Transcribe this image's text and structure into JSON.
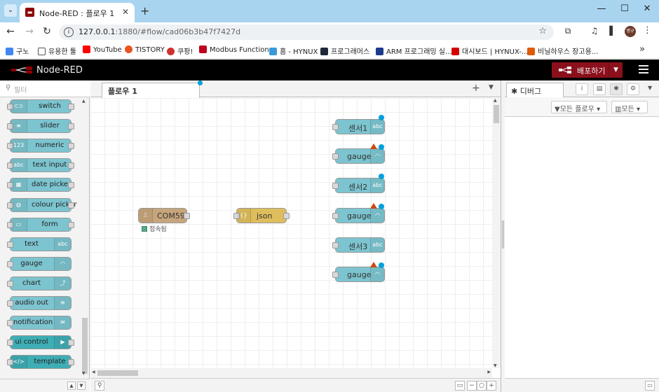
{
  "browser": {
    "tab_title": "Node-RED : 플로우 1",
    "url_host": "127.0.0.1",
    "url_path": ":1880/#flow/cad06b3b47f7427d",
    "profile_label": "병규",
    "bookmarks": [
      {
        "label": "구노",
        "color": "#4285f4"
      },
      {
        "label": "유용한 툴",
        "color": "#555555"
      },
      {
        "label": "YouTube",
        "color": "#ff0000"
      },
      {
        "label": "TISTORY",
        "color": "#eb531f"
      },
      {
        "label": "쿠팡!",
        "color": "#d03030"
      },
      {
        "label": "Modbus Function...",
        "color": "#c00020"
      },
      {
        "label": "홈 - HYNUX",
        "color": "#3a9ad9"
      },
      {
        "label": "프로그래머스",
        "color": "#1e2a3a"
      },
      {
        "label": "ARM 프로그래밍 실...",
        "color": "#1a3a8a"
      },
      {
        "label": "대시보드 | HYNUX-...",
        "color": "#d40000"
      },
      {
        "label": "비닐하우스 장고용...",
        "color": "#e05a00"
      }
    ]
  },
  "nodered": {
    "title": "Node-RED",
    "deploy_label": "배포하기",
    "accent": "#8c101c"
  },
  "palette": {
    "filter_placeholder": "필터",
    "nodes": [
      {
        "label": "switch",
        "icon": "toggle-icon",
        "side": "left",
        "style": "light"
      },
      {
        "label": "slider",
        "icon": "slider-icon",
        "side": "left",
        "style": "light"
      },
      {
        "label": "numeric",
        "icon": "123",
        "side": "left",
        "style": "light"
      },
      {
        "label": "text input",
        "icon": "abc",
        "side": "left",
        "style": "light"
      },
      {
        "label": "date picker",
        "icon": "calendar-icon",
        "side": "left",
        "style": "light"
      },
      {
        "label": "colour picker",
        "icon": "palette-icon",
        "side": "left",
        "style": "light"
      },
      {
        "label": "form",
        "icon": "form-icon",
        "side": "left",
        "style": "light"
      },
      {
        "label": "text",
        "icon": "abc",
        "side": "right",
        "style": "light"
      },
      {
        "label": "gauge",
        "icon": "gauge-icon",
        "side": "right",
        "style": "light"
      },
      {
        "label": "chart",
        "icon": "chart-icon",
        "side": "right",
        "style": "light"
      },
      {
        "label": "audio out",
        "icon": "wifi-icon",
        "side": "right",
        "style": "light"
      },
      {
        "label": "notification",
        "icon": "envelope-icon",
        "side": "right",
        "style": "light"
      },
      {
        "label": "ui control",
        "icon": "play-icon",
        "side": "right",
        "style": "dark"
      },
      {
        "label": "template",
        "icon": "code-icon",
        "side": "left",
        "style": "dark"
      }
    ]
  },
  "workspace": {
    "tab_label": "플로우 1",
    "nodes": {
      "com": {
        "label": "COM59",
        "status": "접속됨",
        "color": "#c7a57c"
      },
      "json": {
        "label": "json",
        "color": "#debd5c"
      },
      "sensor1": {
        "label": "센서1",
        "icon": "abc"
      },
      "gauge1": {
        "label": "gauge"
      },
      "sensor2": {
        "label": "센서2",
        "icon": "abc"
      },
      "gauge2": {
        "label": "gauge"
      },
      "sensor3": {
        "label": "센서3",
        "icon": "abc"
      },
      "gauge3": {
        "label": "gauge"
      }
    }
  },
  "sidebar": {
    "tab_label": "디버그",
    "filter_flows": "모든 플로우",
    "filter_all": "모든"
  }
}
